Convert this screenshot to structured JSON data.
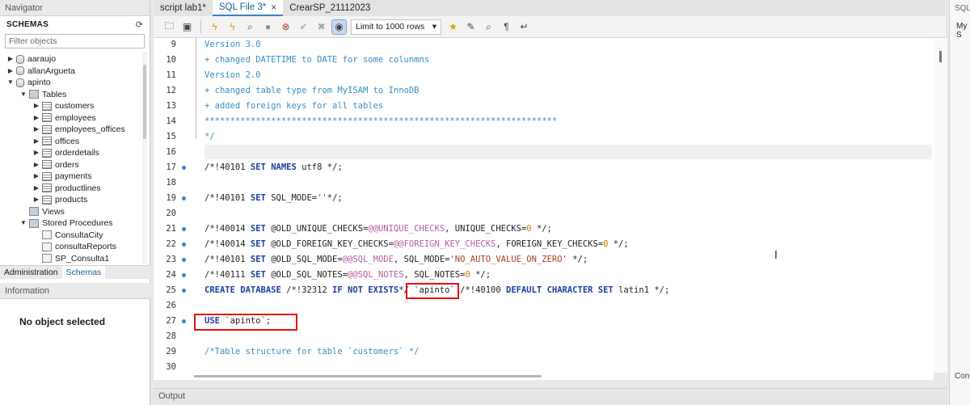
{
  "navigator": {
    "title": "Navigator",
    "schemas_label": "SCHEMAS",
    "filter_placeholder": "Filter objects",
    "tree": [
      {
        "label": "aaraujo",
        "type": "db",
        "level": 0,
        "twisty": "▶"
      },
      {
        "label": "allanArgueta",
        "type": "db",
        "level": 0,
        "twisty": "▶"
      },
      {
        "label": "apinto",
        "type": "db",
        "level": 0,
        "twisty": "▼"
      },
      {
        "label": "Tables",
        "type": "folder",
        "level": 1,
        "twisty": "▼"
      },
      {
        "label": "customers",
        "type": "table",
        "level": 2,
        "twisty": "▶"
      },
      {
        "label": "employees",
        "type": "table",
        "level": 2,
        "twisty": "▶"
      },
      {
        "label": "employees_offices",
        "type": "table",
        "level": 2,
        "twisty": "▶"
      },
      {
        "label": "offices",
        "type": "table",
        "level": 2,
        "twisty": "▶"
      },
      {
        "label": "orderdetails",
        "type": "table",
        "level": 2,
        "twisty": "▶"
      },
      {
        "label": "orders",
        "type": "table",
        "level": 2,
        "twisty": "▶"
      },
      {
        "label": "payments",
        "type": "table",
        "level": 2,
        "twisty": "▶"
      },
      {
        "label": "productlines",
        "type": "table",
        "level": 2,
        "twisty": "▶"
      },
      {
        "label": "products",
        "type": "table",
        "level": 2,
        "twisty": "▶"
      },
      {
        "label": "Views",
        "type": "folder",
        "level": 1,
        "twisty": ""
      },
      {
        "label": "Stored Procedures",
        "type": "folder",
        "level": 1,
        "twisty": "▼"
      },
      {
        "label": "ConsultaCity",
        "type": "routine",
        "level": 2,
        "twisty": ""
      },
      {
        "label": "consultaReports",
        "type": "routine",
        "level": 2,
        "twisty": ""
      },
      {
        "label": "SP_Consulta1",
        "type": "routine",
        "level": 2,
        "twisty": ""
      }
    ],
    "bottom_tabs": [
      "Administration",
      "Schemas"
    ],
    "info_title": "Information",
    "no_object": "No object selected"
  },
  "tabs": [
    {
      "label": "script lab1*",
      "active": false
    },
    {
      "label": "SQL File 3*",
      "active": true
    },
    {
      "label": "CrearSP_21112023",
      "active": false
    }
  ],
  "toolbar": {
    "limit_label": "Limit to 1000 rows"
  },
  "editor": {
    "lines": [
      {
        "n": "9",
        "dot": false,
        "tokens": [
          [
            "com",
            "Version 3.0"
          ]
        ]
      },
      {
        "n": "10",
        "dot": false,
        "tokens": [
          [
            "com",
            "+ changed DATETIME to DATE for some colunmns"
          ]
        ]
      },
      {
        "n": "11",
        "dot": false,
        "tokens": [
          [
            "com",
            "Version 2.0"
          ]
        ]
      },
      {
        "n": "12",
        "dot": false,
        "tokens": [
          [
            "com",
            "+ changed table type from MyISAM to InnoDB"
          ]
        ]
      },
      {
        "n": "13",
        "dot": false,
        "tokens": [
          [
            "com",
            "+ added foreign keys for all tables"
          ]
        ]
      },
      {
        "n": "14",
        "dot": false,
        "tokens": [
          [
            "com",
            "*********************************************************************"
          ]
        ]
      },
      {
        "n": "15",
        "dot": false,
        "tokens": [
          [
            "com",
            "*/"
          ]
        ]
      },
      {
        "n": "16",
        "dot": false,
        "current": true,
        "tokens": []
      },
      {
        "n": "17",
        "dot": true,
        "tokens": [
          [
            "d",
            "/*!40101 "
          ],
          [
            "kw",
            "SET NAMES"
          ],
          [
            "d",
            " utf8 */;"
          ]
        ]
      },
      {
        "n": "18",
        "dot": false,
        "tokens": []
      },
      {
        "n": "19",
        "dot": true,
        "tokens": [
          [
            "d",
            "/*!40101 "
          ],
          [
            "kw",
            "SET"
          ],
          [
            "d",
            " SQL_MODE="
          ],
          [
            "str",
            "''"
          ],
          [
            "d",
            "*/;"
          ]
        ]
      },
      {
        "n": "20",
        "dot": false,
        "tokens": []
      },
      {
        "n": "21",
        "dot": true,
        "tokens": [
          [
            "d",
            "/*!40014 "
          ],
          [
            "kw",
            "SET"
          ],
          [
            "d",
            " @OLD_UNIQUE_CHECKS="
          ],
          [
            "var",
            "@@UNIQUE_CHECKS"
          ],
          [
            "d",
            ", UNIQUE_CHECKS="
          ],
          [
            "num",
            "0"
          ],
          [
            "d",
            " */;"
          ]
        ]
      },
      {
        "n": "22",
        "dot": true,
        "tokens": [
          [
            "d",
            "/*!40014 "
          ],
          [
            "kw",
            "SET"
          ],
          [
            "d",
            " @OLD_FOREIGN_KEY_CHECKS="
          ],
          [
            "var",
            "@@FOREIGN_KEY_CHECKS"
          ],
          [
            "d",
            ", FOREIGN_KEY_CHECKS="
          ],
          [
            "num",
            "0"
          ],
          [
            "d",
            " */;"
          ]
        ]
      },
      {
        "n": "23",
        "dot": true,
        "tokens": [
          [
            "d",
            "/*!40101 "
          ],
          [
            "kw",
            "SET"
          ],
          [
            "d",
            " @OLD_SQL_MODE="
          ],
          [
            "var",
            "@@SQL_MODE"
          ],
          [
            "d",
            ", SQL_MODE="
          ],
          [
            "str",
            "'NO_AUTO_VALUE_ON_ZERO'"
          ],
          [
            "d",
            " */;"
          ]
        ]
      },
      {
        "n": "24",
        "dot": true,
        "tokens": [
          [
            "d",
            "/*!40111 "
          ],
          [
            "kw",
            "SET"
          ],
          [
            "d",
            " @OLD_SQL_NOTES="
          ],
          [
            "var",
            "@@SQL_NOTES"
          ],
          [
            "d",
            ", SQL_NOTES="
          ],
          [
            "num",
            "0"
          ],
          [
            "d",
            " */;"
          ]
        ]
      },
      {
        "n": "25",
        "dot": true,
        "tokens": [
          [
            "kw",
            "CREATE DATABASE"
          ],
          [
            "d",
            " /*!32312 "
          ],
          [
            "kw",
            "IF NOT EXISTS"
          ],
          [
            "d",
            "*/ "
          ],
          [
            "d",
            "`apinto`"
          ],
          [
            "d",
            " /*!40100 "
          ],
          [
            "kw",
            "DEFAULT CHARACTER SET"
          ],
          [
            "d",
            " latin1 */;"
          ]
        ]
      },
      {
        "n": "26",
        "dot": false,
        "tokens": []
      },
      {
        "n": "27",
        "dot": true,
        "tokens": [
          [
            "kw",
            "USE"
          ],
          [
            "d",
            " `apinto`;"
          ]
        ]
      },
      {
        "n": "28",
        "dot": false,
        "tokens": []
      },
      {
        "n": "29",
        "dot": false,
        "tokens": [
          [
            "com",
            "/*Table structure for table `customers` */"
          ]
        ]
      },
      {
        "n": "30",
        "dot": false,
        "tokens": []
      }
    ]
  },
  "output_label": "Output",
  "right_panel": {
    "title": "SQL",
    "line2": "My S",
    "bottom": "Cont"
  },
  "colors": {
    "comment": "#3a8dc4",
    "keyword": "#1c3f9e",
    "highlight_box": "#e01010",
    "active_tab": "#1a5c9a"
  }
}
